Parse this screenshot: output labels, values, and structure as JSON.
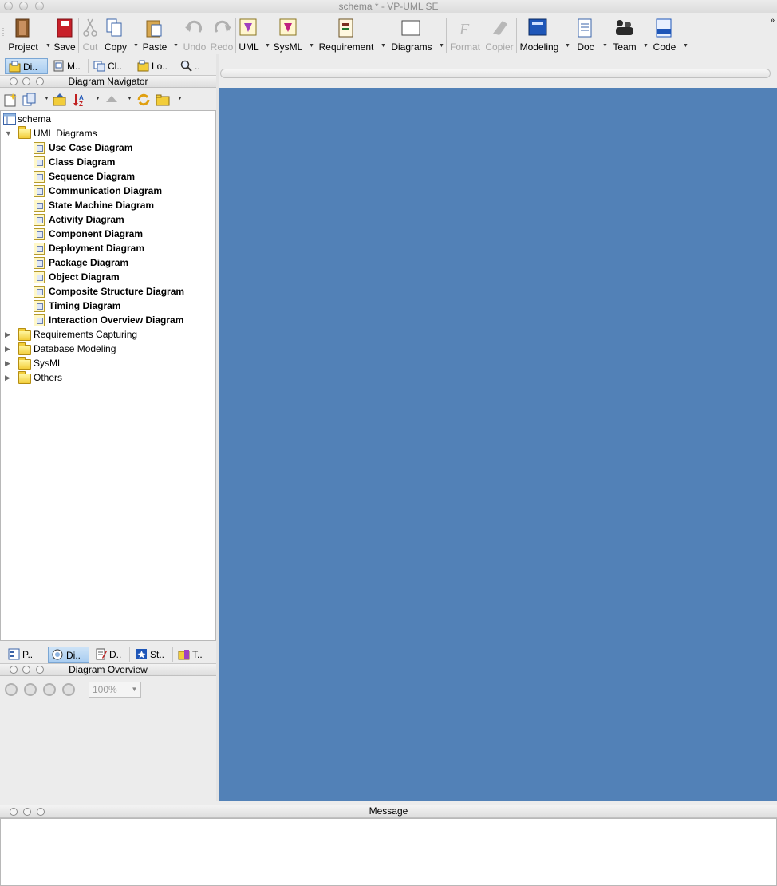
{
  "window": {
    "title": "schema * - VP-UML SE"
  },
  "toolbar": {
    "project": "Project",
    "save": "Save",
    "cut": "Cut",
    "copy": "Copy",
    "paste": "Paste",
    "undo": "Undo",
    "redo": "Redo",
    "uml": "UML",
    "sysml": "SysML",
    "requirement": "Requirement",
    "diagrams": "Diagrams",
    "format": "Format",
    "copier": "Copier",
    "modeling": "Modeling",
    "doc": "Doc",
    "team": "Team",
    "code": "Code",
    "more": "»"
  },
  "top_tabs": [
    {
      "label": "Di..",
      "icon": "diagram-navigator-icon",
      "active": true
    },
    {
      "label": "M..",
      "icon": "model-explorer-icon",
      "active": false
    },
    {
      "label": "Cl..",
      "icon": "class-repository-icon",
      "active": false
    },
    {
      "label": "Lo..",
      "icon": "logical-view-icon",
      "active": false
    },
    {
      "label": "..",
      "icon": "search-icon",
      "active": false
    }
  ],
  "navigator": {
    "title": "Diagram Navigator",
    "root": "schema",
    "uml_folder": "UML Diagrams",
    "uml_diagrams": [
      "Use Case Diagram",
      "Class Diagram",
      "Sequence Diagram",
      "Communication Diagram",
      "State Machine Diagram",
      "Activity Diagram",
      "Component Diagram",
      "Deployment Diagram",
      "Package Diagram",
      "Object Diagram",
      "Composite Structure Diagram",
      "Timing Diagram",
      "Interaction Overview Diagram"
    ],
    "collapsed_folders": [
      "Requirements Capturing",
      "Database Modeling",
      "SysML",
      "Others"
    ]
  },
  "bottom_tabs": [
    {
      "label": "P..",
      "icon": "property-icon",
      "active": false
    },
    {
      "label": "Di..",
      "icon": "diagram-overview-icon",
      "active": true
    },
    {
      "label": "D..",
      "icon": "documentation-icon",
      "active": false
    },
    {
      "label": "St..",
      "icon": "stereotype-icon",
      "active": false
    },
    {
      "label": "T..",
      "icon": "template-icon",
      "active": false
    }
  ],
  "overview": {
    "title": "Diagram Overview",
    "zoom": "100%"
  },
  "message": {
    "title": "Message"
  },
  "colors": {
    "canvas": "#5281b7",
    "active_tab": "#a9cdf1"
  }
}
